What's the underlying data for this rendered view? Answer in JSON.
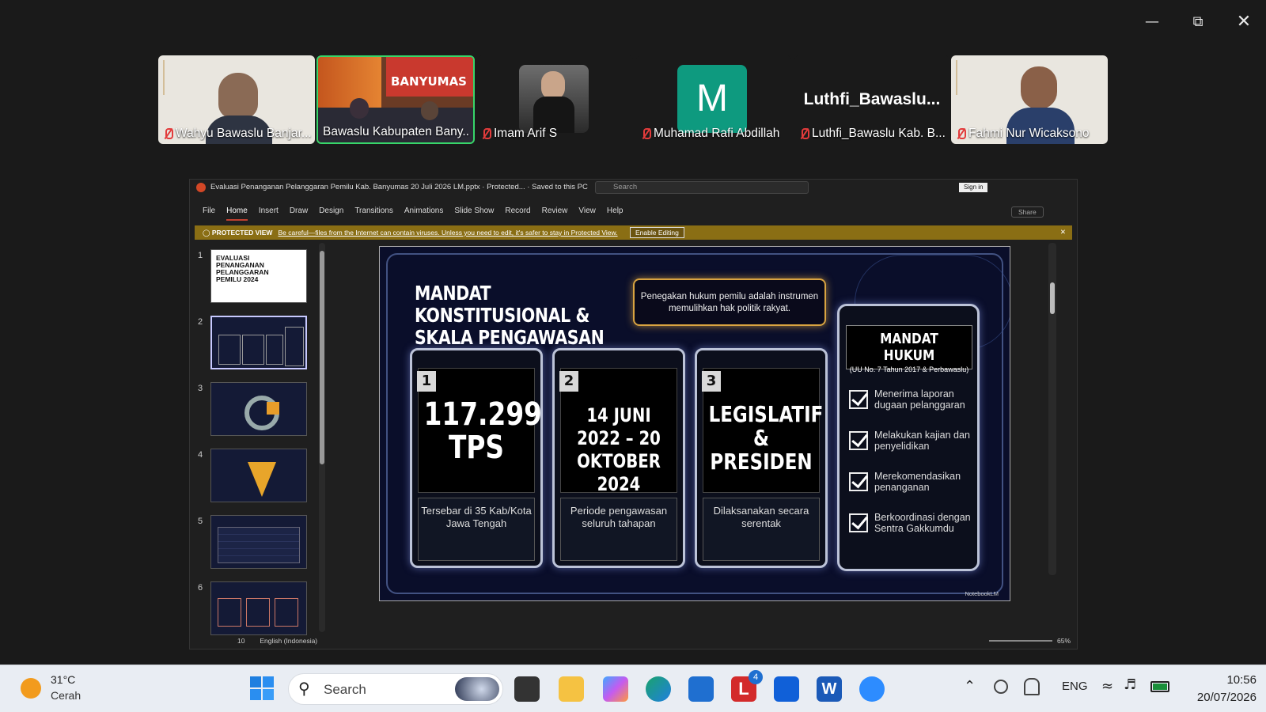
{
  "participants": [
    {
      "name": "Wahyu Bawaslu Banjar..."
    },
    {
      "name": "Bawaslu Kabupaten Bany...",
      "banner": "BANYUMAS"
    },
    {
      "name": "Imam Arif S"
    },
    {
      "name": "Muhamad Rafi Abdillah",
      "initial": "M"
    },
    {
      "name": "Luthfi_Bawaslu Kab. B...",
      "display": "Luthfi_Bawaslu..."
    },
    {
      "name": "Fahmi Nur Wicaksono"
    }
  ],
  "powerpoint": {
    "title": "Evaluasi Penanganan Pelanggaran Pemilu Kab. Banyumas 20 Juli 2026 LM.pptx  ·  Protected...  ·  Saved to this PC",
    "search_placeholder": "Search",
    "sign_in": "Sign in",
    "share": "Share",
    "menu": [
      "File",
      "Home",
      "Insert",
      "Draw",
      "Design",
      "Transitions",
      "Animations",
      "Slide Show",
      "Record",
      "Review",
      "View",
      "Help"
    ],
    "protected_label": "PROTECTED VIEW",
    "protected_msg": "Be careful—files from the Internet can contain viruses. Unless you need to edit, it's safer to stay in Protected View.",
    "enable_editing": "Enable Editing",
    "thumb_numbers": [
      "1",
      "2",
      "3",
      "4",
      "5",
      "6"
    ],
    "thumb1_title": "EVALUASI PENANGANAN PELANGGARAN PEMILU 2024",
    "status_slide": "10",
    "status_lang": "English (Indonesia)",
    "zoom": "65%",
    "notebooklm": "NotebookLM"
  },
  "slide": {
    "title": "MANDAT KONSTITUSIONAL & SKALA PENGAWASAN",
    "quote": "Penegakan hukum pemilu adalah instrumen memulihkan hak politik rakyat.",
    "cards": [
      {
        "num": "1",
        "big": "117.299 TPS",
        "desc": "Tersebar di 35 Kab/Kota Jawa Tengah"
      },
      {
        "num": "2",
        "big": "14 JUNI 2022 – 20 OKTOBER 2024",
        "desc": "Periode pengawasan seluruh tahapan"
      },
      {
        "num": "3",
        "big": "LEGISLATIF & PRESIDEN",
        "desc": "Dilaksanakan secara serentak"
      }
    ],
    "mandat_title": "MANDAT HUKUM",
    "mandat_sub": "(UU No. 7 Tahun 2017 & Perbawaslu)",
    "mandat_items": [
      "Menerima laporan dugaan pelanggaran",
      "Melakukan kajian dan penyelidikan",
      "Merekomendasikan penanganan",
      "Berkoordinasi dengan Sentra Gakkumdu"
    ]
  },
  "taskbar": {
    "weather_temp": "31°C",
    "weather_desc": "Cerah",
    "search_placeholder": "Search",
    "badge": "4",
    "lang": "ENG",
    "time": "10:56",
    "date": "20/07/2026"
  }
}
